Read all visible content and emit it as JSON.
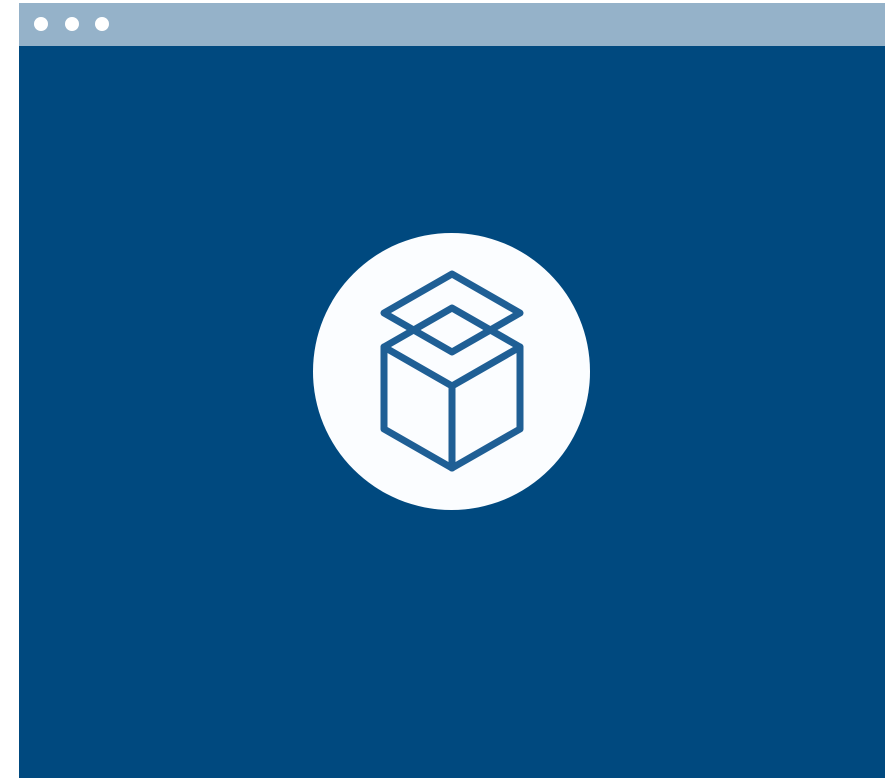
{
  "window": {
    "titlebar_color": "#95b2c9",
    "background_color": "#00497f",
    "controls": [
      "window-control-dot",
      "window-control-dot",
      "window-control-dot"
    ]
  },
  "hero": {
    "icon": "box-layers-icon",
    "icon_color": "#1f5f95",
    "circle_color": "#fbfdff"
  }
}
